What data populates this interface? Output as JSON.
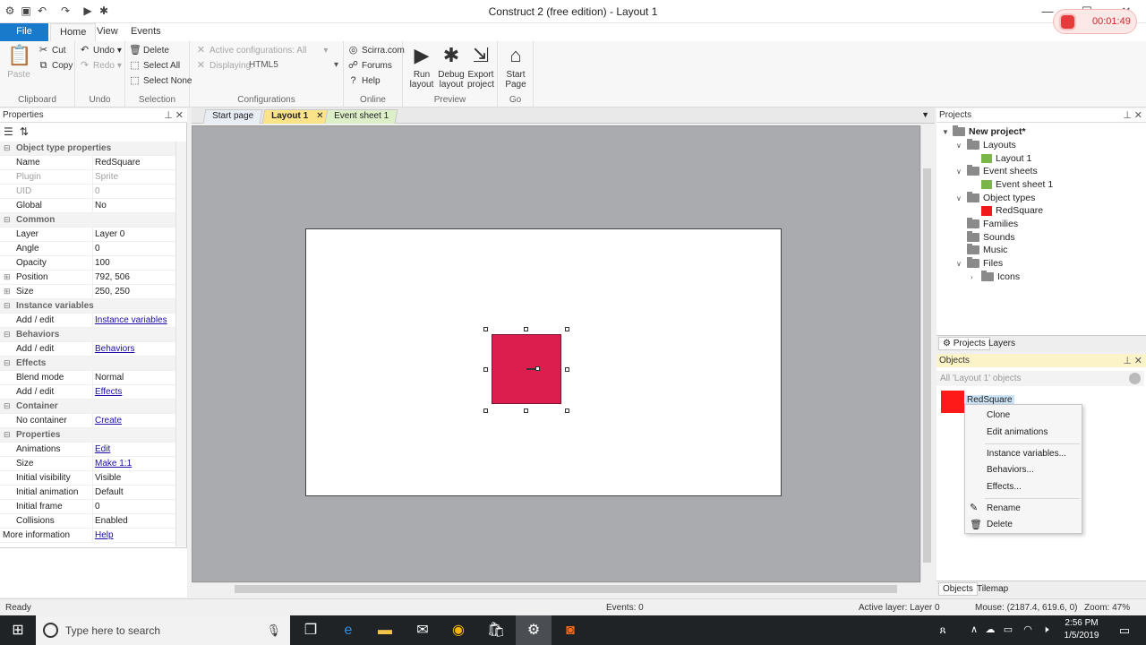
{
  "window": {
    "title": "Construct 2 (free edition) - Layout 1",
    "minimize": "—",
    "maximize": "☐",
    "close": "✕"
  },
  "recorder": {
    "time": "00:01:49"
  },
  "ribbon": {
    "tabs": [
      "File",
      "Home",
      "View",
      "Events"
    ],
    "clipboard": {
      "paste": "Paste",
      "cut": "Cut",
      "copy": "Copy",
      "label": "Clipboard"
    },
    "undo": {
      "undo": "Undo",
      "redo": "Redo",
      "label": "Undo"
    },
    "selection": {
      "delete": "Delete",
      "select_all": "Select All",
      "select_none": "Select None",
      "label": "Selection"
    },
    "configurations": {
      "active": "Active configurations: All",
      "displaying_label": "Displaying:",
      "displaying_value": "HTML5",
      "label": "Configurations"
    },
    "online": {
      "scirra": "Scirra.com",
      "forums": "Forums",
      "help": "Help",
      "label": "Online"
    },
    "preview": {
      "run": [
        "Run",
        "layout"
      ],
      "debug": [
        "Debug",
        "layout"
      ],
      "export": [
        "Export",
        "project"
      ],
      "label": "Preview"
    },
    "go": {
      "start": [
        "Start",
        "Page"
      ],
      "label": "Go"
    }
  },
  "properties": {
    "title": "Properties",
    "rows": [
      {
        "type": "cat",
        "name": "Object type properties"
      },
      {
        "name": "Name",
        "value": "RedSquare"
      },
      {
        "name": "Plugin",
        "value": "Sprite",
        "dim": true
      },
      {
        "name": "UID",
        "value": "0",
        "dim": true
      },
      {
        "name": "Global",
        "value": "No"
      },
      {
        "type": "cat",
        "name": "Common"
      },
      {
        "name": "Layer",
        "value": "Layer 0"
      },
      {
        "name": "Angle",
        "value": "0"
      },
      {
        "name": "Opacity",
        "value": "100"
      },
      {
        "name": "Position",
        "value": "792, 506",
        "exp": true
      },
      {
        "name": "Size",
        "value": "250, 250",
        "exp": true
      },
      {
        "type": "cat",
        "name": "Instance variables"
      },
      {
        "name": "Add / edit",
        "value": "Instance variables",
        "link": true
      },
      {
        "type": "cat",
        "name": "Behaviors"
      },
      {
        "name": "Add / edit",
        "value": "Behaviors",
        "link": true
      },
      {
        "type": "cat",
        "name": "Effects"
      },
      {
        "name": "Blend mode",
        "value": "Normal"
      },
      {
        "name": "Add / edit",
        "value": "Effects",
        "link": true
      },
      {
        "type": "cat",
        "name": "Container"
      },
      {
        "name": "No container",
        "value": "Create",
        "link": true
      },
      {
        "type": "cat",
        "name": "Properties"
      },
      {
        "name": "Animations",
        "value": "Edit",
        "link": true
      },
      {
        "name": "Size",
        "value": "Make 1:1",
        "link": true
      },
      {
        "name": "Initial visibility",
        "value": "Visible"
      },
      {
        "name": "Initial animation",
        "value": "Default"
      },
      {
        "name": "Initial frame",
        "value": "0"
      },
      {
        "name": "Collisions",
        "value": "Enabled"
      },
      {
        "name": "More information",
        "value": "Help",
        "link": true,
        "left": true
      }
    ]
  },
  "doc_tabs": {
    "start": "Start page",
    "layout": "Layout 1",
    "events": "Event sheet 1"
  },
  "projects": {
    "title": "Projects",
    "root": "New project*",
    "layouts": "Layouts",
    "layout1": "Layout 1",
    "event_sheets": "Event sheets",
    "event_sheet1": "Event sheet 1",
    "object_types": "Object types",
    "red_square": "RedSquare",
    "families": "Families",
    "sounds": "Sounds",
    "music": "Music",
    "files": "Files",
    "icons": "Icons",
    "tabs": [
      "Projects",
      "Layers"
    ]
  },
  "objects": {
    "title": "Objects",
    "filter": "All 'Layout 1' objects",
    "item": "RedSquare",
    "tabs": [
      "Objects",
      "Tilemap"
    ]
  },
  "context_menu": {
    "items": [
      "Clone",
      "Edit animations",
      "Instance variables...",
      "Behaviors...",
      "Effects...",
      "Rename",
      "Delete"
    ]
  },
  "status": {
    "ready": "Ready",
    "events": "Events: 0",
    "active_layer": "Active layer: Layer 0",
    "mouse": "Mouse: (2187.4, 619.6, 0)",
    "zoom": "Zoom: 47%"
  },
  "taskbar": {
    "search": "Type here to search",
    "time": "2:56 PM",
    "date": "1/5/2019"
  },
  "colors": {
    "sprite": "#dc1e4e",
    "accent": "#1979ca"
  }
}
